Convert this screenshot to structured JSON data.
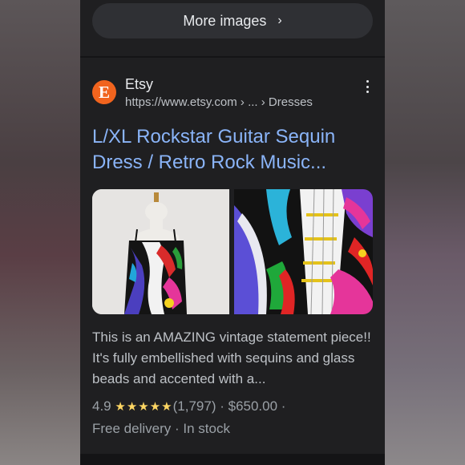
{
  "more_images": {
    "label": "More images",
    "chevron": "›"
  },
  "result": {
    "favicon_letter": "E",
    "site_name": "Etsy",
    "url": "https://www.etsy.com › ... › Dresses",
    "title": "L/XL Rockstar Guitar Sequin Dress / Retro Rock Music...",
    "snippet": "This is an AMAZING vintage statement piece!! It's fully embellished with sequins and glass beads and accented with a...",
    "rating": "4.9",
    "stars": "★★★★★",
    "rating_count": "(1,797)",
    "price": "· $650.00 ·",
    "delivery": "Free delivery · In stock"
  },
  "colors": {
    "background": "#1f1f21",
    "link_blue": "#8ab4f8",
    "star_yellow": "#fdd663",
    "etsy_orange": "#f1641e"
  },
  "icons": [
    "chevron-right-icon",
    "etsy-favicon-icon",
    "more-options-icon",
    "star-icon"
  ]
}
